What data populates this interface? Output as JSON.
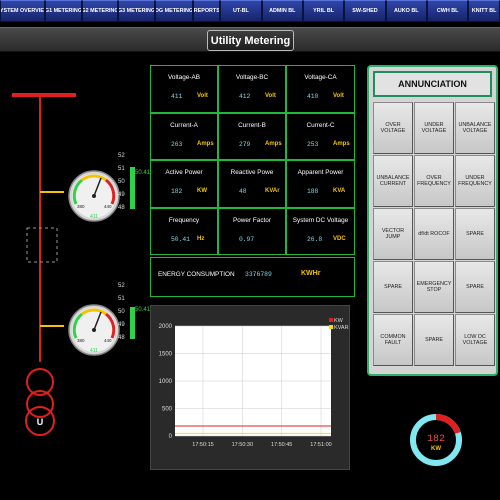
{
  "nav": {
    "tabs": [
      {
        "label": "SYSTEM OVERVIEW",
        "w": 47
      },
      {
        "label": "G1 METERING",
        "w": 38
      },
      {
        "label": "G2 METERING",
        "w": 38
      },
      {
        "label": "G3 METERING",
        "w": 38
      },
      {
        "label": "DG METERING",
        "w": 40
      },
      {
        "label": "REPORTS",
        "w": 28
      },
      {
        "label": "UT-BL",
        "w": 43
      },
      {
        "label": "ADMIN BL",
        "w": 43
      },
      {
        "label": "YRIL BL",
        "w": 43
      },
      {
        "label": "SW-SHED",
        "w": 43
      },
      {
        "label": "AUKO BL",
        "w": 43
      },
      {
        "label": "CWH BL",
        "w": 43
      },
      {
        "label": "KNITT BL",
        "w": 33
      }
    ]
  },
  "title": "Utility Metering",
  "sld": {
    "bus_color": "#e02020",
    "feeder_color": "#f5c400",
    "gauge1": {
      "value": "411",
      "min": "380",
      "max": "440",
      "label_a": "415",
      "led_labels": [
        "52",
        "51",
        "50",
        "49",
        "48"
      ],
      "led_value": "50.41"
    },
    "gauge2": {
      "value": "411",
      "min": "380",
      "max": "440",
      "label_a": "415",
      "led_labels": [
        "52",
        "51",
        "50",
        "49",
        "48"
      ],
      "led_value": "50.41"
    },
    "transformer_label": "U"
  },
  "metering": {
    "cells": [
      {
        "label": "Voltage-AB",
        "value": "411",
        "unit": "Volt"
      },
      {
        "label": "Voltage-BC",
        "value": "412",
        "unit": "Volt"
      },
      {
        "label": "Voltage-CA",
        "value": "410",
        "unit": "Volt"
      },
      {
        "label": "Current-A",
        "value": "263",
        "unit": "Amps"
      },
      {
        "label": "Current-B",
        "value": "279",
        "unit": "Amps"
      },
      {
        "label": "Current-C",
        "value": "253",
        "unit": "Amps"
      },
      {
        "label": "Active Power",
        "value": "182",
        "unit": "KW"
      },
      {
        "label": "Reactive Powe",
        "value": "48",
        "unit": "KVAr"
      },
      {
        "label": "Apparent Power",
        "value": "188",
        "unit": "KVA"
      },
      {
        "label": "Frequency",
        "value": "50.41",
        "unit": "Hz"
      },
      {
        "label": "Power Factor",
        "value": "0.97",
        "unit": ""
      },
      {
        "label": "System DC Voltage",
        "value": "26.8",
        "unit": "VDC"
      }
    ],
    "energy": {
      "label": "ENERGY CONSUMPTION",
      "value": "3376789",
      "unit": "KWHr"
    }
  },
  "trend": {
    "chart_data": {
      "type": "line",
      "x": [
        "17:50:15",
        "17:50:30",
        "17:50:45",
        "17:51:00"
      ],
      "ylim": [
        0,
        2000
      ],
      "yticks": [
        "2000",
        "1500",
        "1000",
        "500",
        "0"
      ],
      "series": [
        {
          "name": "KW",
          "color": "#e02020",
          "values": [
            182,
            182,
            182,
            182
          ]
        },
        {
          "name": "KVAR",
          "color": "#f5e000",
          "values": [
            48,
            48,
            48,
            48
          ]
        }
      ],
      "legend": "top-right"
    }
  },
  "annunciation": {
    "title": "ANNUNCIATION",
    "alarms": [
      "OVER VOLTAGE",
      "UNDER VOLTAGE",
      "UNBALANCE VOLTAGE",
      "UNBALANCE CURRENT",
      "OVER FREQUENCY",
      "UNDER FREQUENCY",
      "VECTOR JUMP",
      "df/dt ROCOF",
      "SPARE",
      "SPARE",
      "EMERGENCY STOP",
      "SPARE",
      "COMMON FAULT",
      "SPARE",
      "LOW DC VOLTAGE"
    ]
  },
  "donut": {
    "value": "182",
    "unit": "KW",
    "fraction": 0.2,
    "track_color": "#7fe8f0",
    "fill_color": "#e02020"
  }
}
